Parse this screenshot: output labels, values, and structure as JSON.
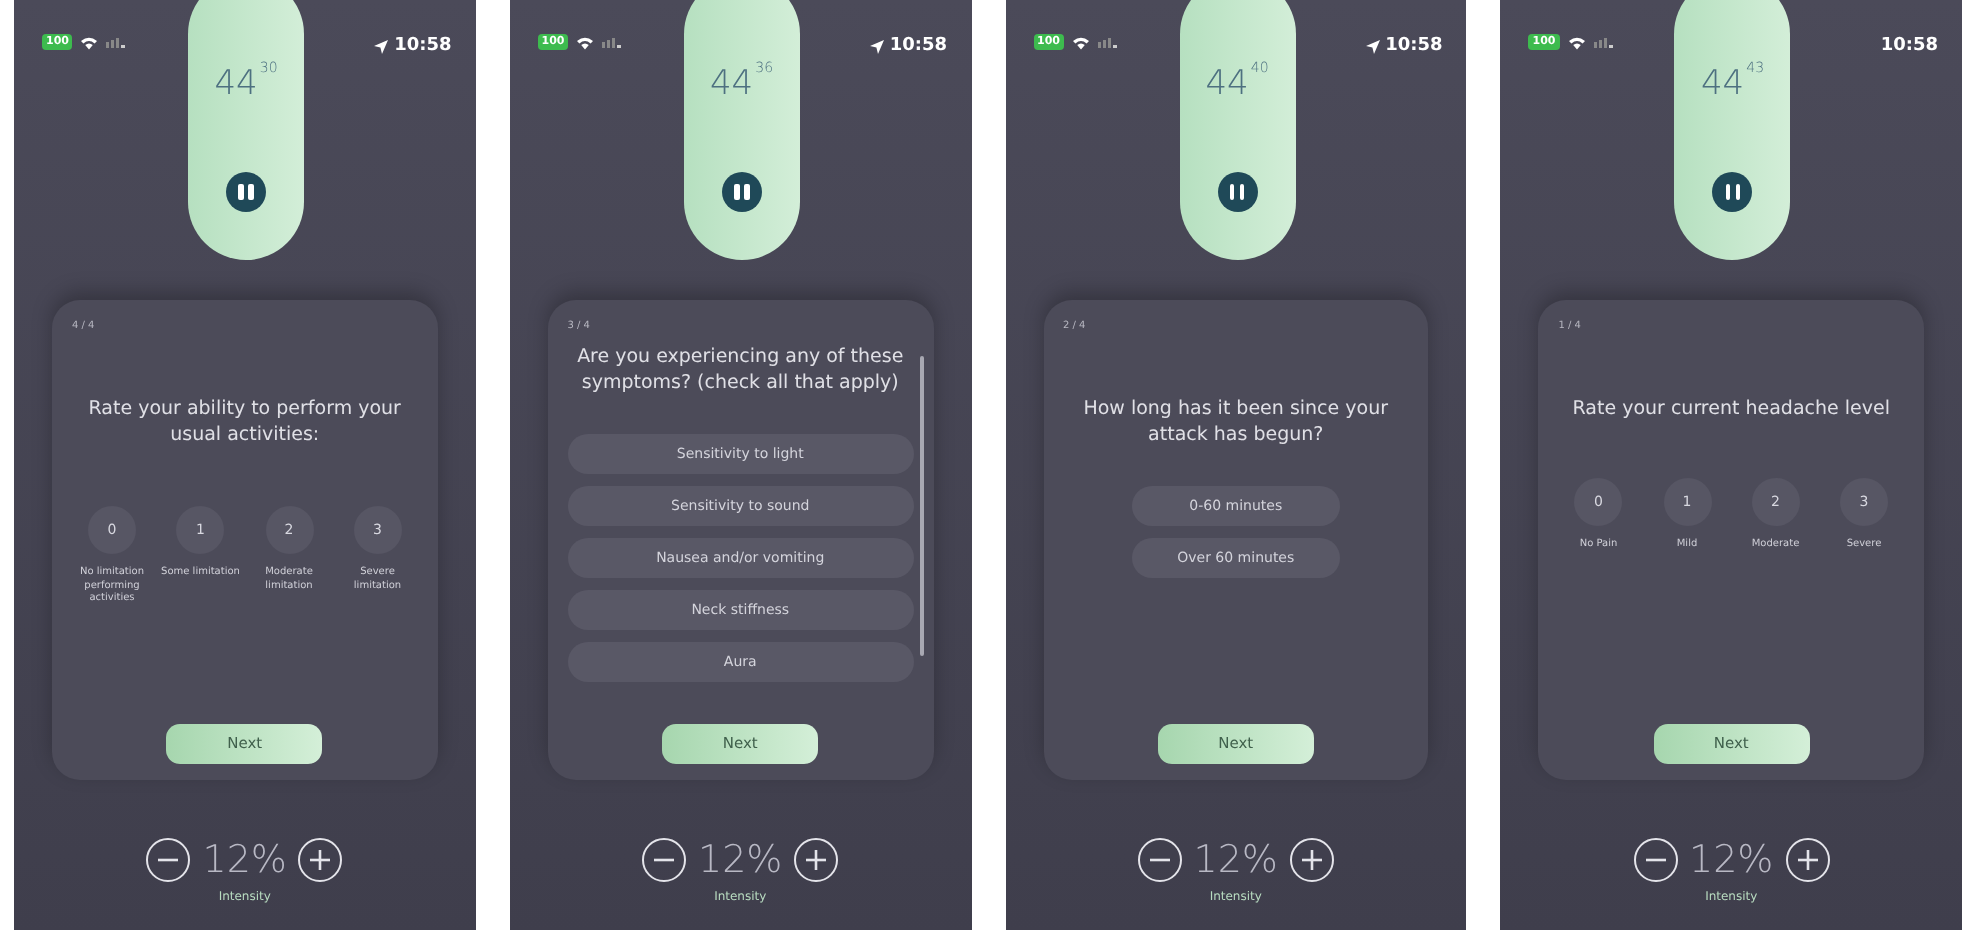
{
  "phones": [
    {
      "status": {
        "battery": "100",
        "time": "10:58",
        "location_arrow": true
      },
      "timer": {
        "minutes": "44",
        "seconds": "30"
      },
      "card": {
        "progress": "4 / 4",
        "question": "Rate your ability to perform your usual activities:",
        "kind": "scale",
        "scrollbar": false,
        "options": [
          {
            "value": "0",
            "label": "No limitation performing activities"
          },
          {
            "value": "1",
            "label": "Some limitation"
          },
          {
            "value": "2",
            "label": "Moderate limitation"
          },
          {
            "value": "3",
            "label": "Severe limitation"
          }
        ],
        "button": "Next"
      },
      "intensity": {
        "value": "12%",
        "label": "Intensity"
      }
    },
    {
      "status": {
        "battery": "100",
        "time": "10:58",
        "location_arrow": true
      },
      "timer": {
        "minutes": "44",
        "seconds": "36"
      },
      "card": {
        "progress": "3 / 4",
        "question": "Are you experiencing any of these symptoms? (check all that apply)",
        "kind": "list",
        "scrollbar": true,
        "options": [
          {
            "label": "Sensitivity to light"
          },
          {
            "label": "Sensitivity to sound"
          },
          {
            "label": "Nausea and/or vomiting"
          },
          {
            "label": "Neck stiffness"
          },
          {
            "label": "Aura"
          }
        ],
        "button": "Next"
      },
      "intensity": {
        "value": "12%",
        "label": "Intensity"
      }
    },
    {
      "status": {
        "battery": "100",
        "time": "10:58",
        "location_arrow": true
      },
      "timer": {
        "minutes": "44",
        "seconds": "40"
      },
      "card": {
        "progress": "2 / 4",
        "question": "How long has it been since your attack has begun?",
        "kind": "choice",
        "scrollbar": false,
        "options": [
          {
            "label": "0-60 minutes"
          },
          {
            "label": "Over 60 minutes"
          }
        ],
        "button": "Next"
      },
      "intensity": {
        "value": "12%",
        "label": "Intensity"
      }
    },
    {
      "status": {
        "battery": "100",
        "time": "10:58",
        "location_arrow": false
      },
      "timer": {
        "minutes": "44",
        "seconds": "43"
      },
      "card": {
        "progress": "1 / 4",
        "question": "Rate your current headache level",
        "kind": "scale",
        "scrollbar": false,
        "options": [
          {
            "value": "0",
            "label": "No Pain"
          },
          {
            "value": "1",
            "label": "Mild"
          },
          {
            "value": "2",
            "label": "Moderate"
          },
          {
            "value": "3",
            "label": "Severe"
          }
        ],
        "button": "Next"
      },
      "intensity": {
        "value": "12%",
        "label": "Intensity"
      }
    }
  ]
}
